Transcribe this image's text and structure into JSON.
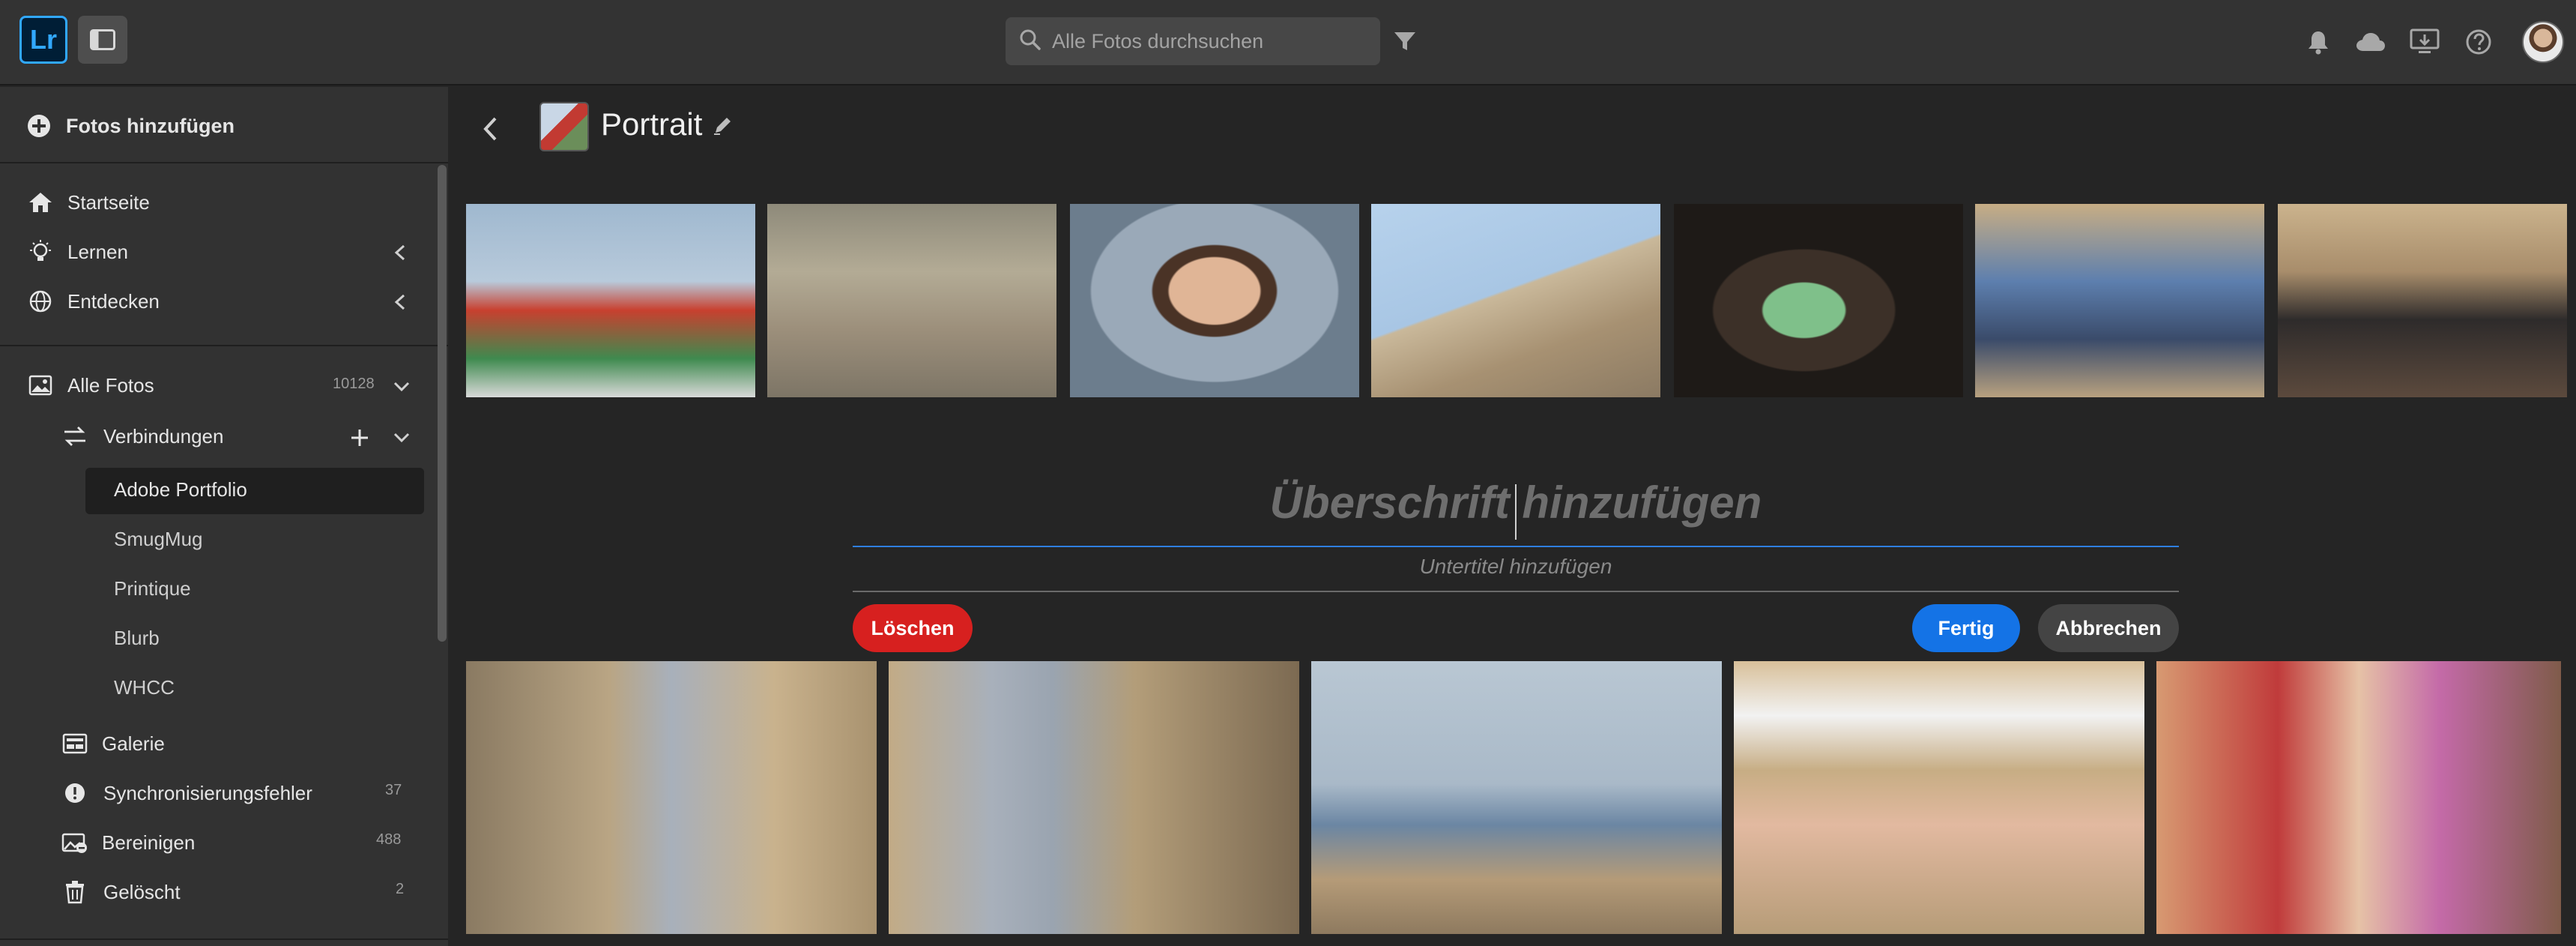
{
  "app": {
    "logo_text": "Lr",
    "accent_color": "#31a8ff"
  },
  "search": {
    "placeholder": "Alle Fotos durchsuchen"
  },
  "topbar_icons": [
    "panel-toggle-icon",
    "search-icon",
    "filter-icon",
    "bell-icon",
    "cloud-icon",
    "monitor-icon",
    "help-icon",
    "user-avatar"
  ],
  "sidebar": {
    "add_photos": "Fotos hinzufügen",
    "home": "Startseite",
    "learn": "Lernen",
    "discover": "Entdecken",
    "all_photos": {
      "label": "Alle Fotos",
      "count": "10128"
    },
    "connections": {
      "label": "Verbindungen"
    },
    "services": [
      "Adobe Portfolio",
      "SmugMug",
      "Printique",
      "Blurb",
      "WHCC"
    ],
    "selected_service": "Adobe Portfolio",
    "gallery": "Galerie",
    "sync_errors": {
      "label": "Synchronisierungsfehler",
      "count": "37"
    },
    "cleanup": {
      "label": "Bereinigen",
      "count": "488"
    },
    "deleted": {
      "label": "Gelöscht",
      "count": "2"
    }
  },
  "album": {
    "title": "Portrait"
  },
  "editor": {
    "heading_placeholder": "Überschrift hinzufügen",
    "subtitle_placeholder": "Untertitel hinzufügen",
    "delete_label": "Löschen",
    "done_label": "Fertig",
    "cancel_label": "Abbrechen"
  },
  "colors": {
    "delete": "#d7201f",
    "done": "#1473e6",
    "cancel": "#444444",
    "heading_underline": "#2f7fe0"
  }
}
